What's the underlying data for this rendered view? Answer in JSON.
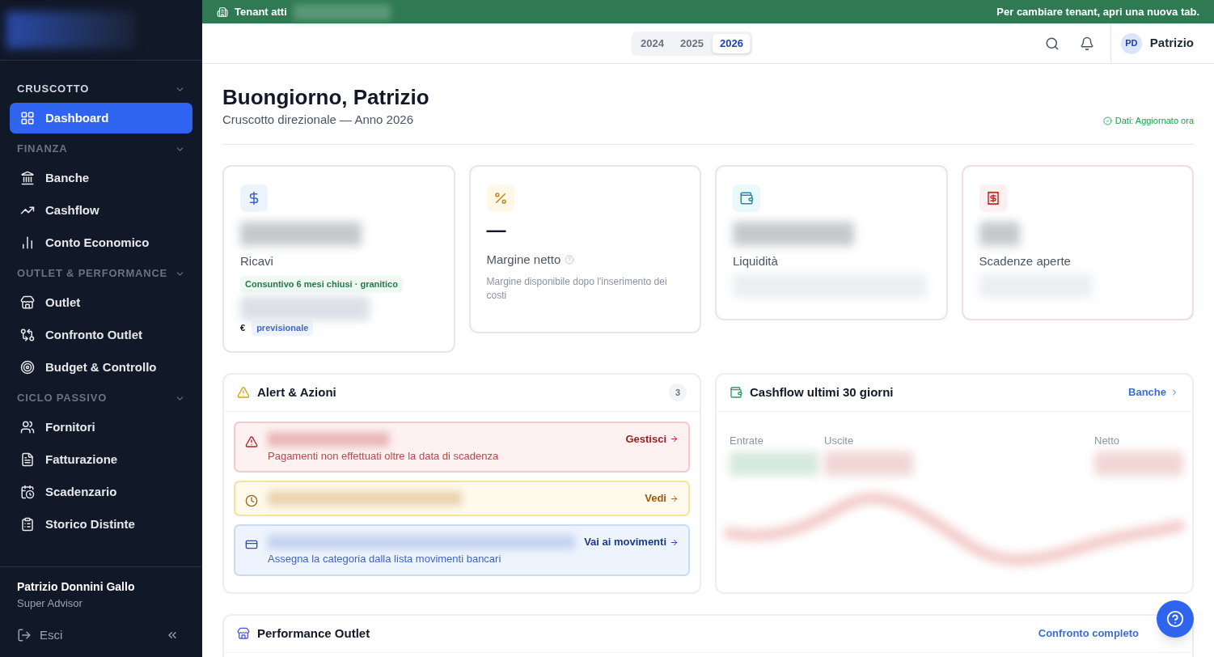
{
  "banner": {
    "left": "Tenant atti",
    "right": "Per cambiare tenant, apri una nuova tab."
  },
  "sidebar": {
    "sections": [
      {
        "title": "CRUSCOTTO",
        "active": true,
        "items": [
          {
            "label": "Dashboard",
            "selected": true
          }
        ]
      },
      {
        "title": "FINANZA",
        "active": false,
        "items": [
          {
            "label": "Banche",
            "selected": false
          },
          {
            "label": "Cashflow",
            "selected": false
          },
          {
            "label": "Conto Economico",
            "selected": false
          }
        ]
      },
      {
        "title": "OUTLET & PERFORMANCE",
        "active": false,
        "items": [
          {
            "label": "Outlet",
            "selected": false
          },
          {
            "label": "Confronto Outlet",
            "selected": false
          },
          {
            "label": "Budget & Controllo",
            "selected": false
          }
        ]
      },
      {
        "title": "CICLO PASSIVO",
        "active": false,
        "items": [
          {
            "label": "Fornitori",
            "selected": false
          },
          {
            "label": "Fatturazione",
            "selected": false
          },
          {
            "label": "Scadenzario",
            "selected": false
          },
          {
            "label": "Storico Distinte",
            "selected": false
          }
        ]
      }
    ],
    "user": {
      "name": "Patrizio Donnini Gallo",
      "role": "Super Advisor"
    },
    "logout": "Esci"
  },
  "header": {
    "years": [
      {
        "label": "2024",
        "selected": false
      },
      {
        "label": "2025",
        "selected": false
      },
      {
        "label": "2026",
        "selected": true
      }
    ],
    "initials": "PD",
    "user": "Patrizio"
  },
  "page": {
    "title": "Buongiorno, Patrizio",
    "subtitle": "Cruscotto direzionale — Anno 2026",
    "status": "Dati: Aggiornato ora"
  },
  "kpis": [
    {
      "kind": "revenue",
      "label": "Ricavi",
      "badge": "Consuntivo 6 mesi chiusi · granitico",
      "currency": "€",
      "tag": "previsionale"
    },
    {
      "kind": "margin",
      "value": "—",
      "label": "Margine netto",
      "note": "Margine disponibile dopo l'inserimento dei costi"
    },
    {
      "kind": "liquidity",
      "label": "Liquidità"
    },
    {
      "kind": "due",
      "label": "Scadenze aperte"
    }
  ],
  "alerts": {
    "title": "Alert & Azioni",
    "count": "3",
    "items": [
      {
        "kind": "danger",
        "description": "Pagamenti non effettuati oltre la data di scadenza",
        "action": "Gestisci"
      },
      {
        "kind": "warning",
        "action": "Vedi"
      },
      {
        "kind": "info",
        "description": "Assegna la categoria dalla lista movimenti bancari",
        "action": "Vai ai movimenti"
      }
    ]
  },
  "cashflow": {
    "title": "Cashflow ultimi 30 giorni",
    "link": "Banche",
    "columns": [
      "Entrate",
      "Uscite",
      "Netto"
    ]
  },
  "performance": {
    "title": "Performance Outlet",
    "link": "Confronto completo"
  }
}
